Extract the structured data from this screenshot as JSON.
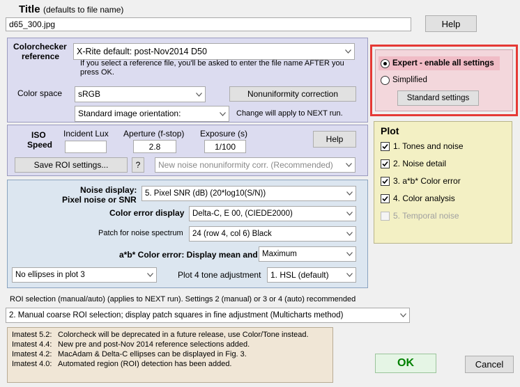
{
  "title_section": {
    "label": "Title",
    "hint": "(defaults to file name)",
    "value": "d65_300.jpg",
    "help": "Help"
  },
  "colorchecker": {
    "label_line1": "Colorchecker",
    "label_line2": "reference",
    "reference_value": "X-Rite default:  post-Nov2014  D50",
    "note_line1": "If you select a reference file, you'll be asked to enter the file name AFTER you",
    "note_line2": "press OK.",
    "color_space_label": "Color space",
    "color_space_value": "sRGB",
    "nonuniformity_button": "Nonuniformity correction",
    "orientation_value": "Standard image orientation:",
    "orientation_note": "Change will apply to NEXT run."
  },
  "iso": {
    "label_line1": "ISO",
    "label_line2": "Speed",
    "incident_lux_label": "Incident Lux",
    "incident_lux_value": "",
    "aperture_label": "Aperture (f-stop)",
    "aperture_value": "2.8",
    "exposure_label": "Exposure (s)",
    "exposure_value": "1/100",
    "help": "Help",
    "save_roi": "Save ROI settings...",
    "question": "?",
    "noise_corr_value": "New noise nonuniformity corr. (Recommended)"
  },
  "noise": {
    "noise_display_line1": "Noise display:",
    "noise_display_line2": "Pixel noise or SNR",
    "noise_display_value": "5. Pixel SNR (dB)  (20*log10(S/N))",
    "color_error_label": "Color error display",
    "color_error_value": "Delta-C, E 00, (CIEDE2000)",
    "patch_label": "Patch for noise spectrum",
    "patch_value": "24  (row 4, col 6)  Black",
    "ab_label": "a*b* Color error: Display mean and",
    "ab_value": "Maximum",
    "ellipses_value": "No ellipses in plot 3",
    "plot4_label": "Plot 4 tone adjustment",
    "plot4_value": "1. HSL (default)"
  },
  "roi": {
    "label": "ROI selection (manual/auto) (applies to NEXT run). Settings 2 (manual) or 3 or 4 (auto) recommended",
    "value": "2. Manual coarse ROI selection; display patch squares in fine adjustment (Multicharts method)"
  },
  "notes": [
    {
      "version": "Imatest 5.2:",
      "text": "Colorcheck will be deprecated in a future release, use Color/Tone instead."
    },
    {
      "version": "Imatest 4.4:",
      "text": "New pre and post-Nov 2014 reference selections added."
    },
    {
      "version": "Imatest 4.2:",
      "text": "MacAdam & Delta-C ellipses can be displayed in Fig. 3."
    },
    {
      "version": "Imatest 4.0:",
      "text": "Automated region (ROI) detection has been added."
    }
  ],
  "mode": {
    "expert_label": "Expert - enable all settings",
    "simplified_label": "Simplified",
    "standard_button": "Standard settings",
    "selected": "expert",
    "highlight_color": "#e53935"
  },
  "plot": {
    "title": "Plot",
    "items": [
      {
        "label": "1. Tones and noise",
        "checked": true,
        "enabled": true
      },
      {
        "label": "2. Noise detail",
        "checked": true,
        "enabled": true
      },
      {
        "label": "3. a*b* Color error",
        "checked": true,
        "enabled": true
      },
      {
        "label": "4. Color analysis",
        "checked": true,
        "enabled": true
      },
      {
        "label": "5. Temporal noise",
        "checked": false,
        "enabled": false
      }
    ]
  },
  "actions": {
    "ok": "OK",
    "cancel": "Cancel",
    "ok_color": "#008000"
  }
}
